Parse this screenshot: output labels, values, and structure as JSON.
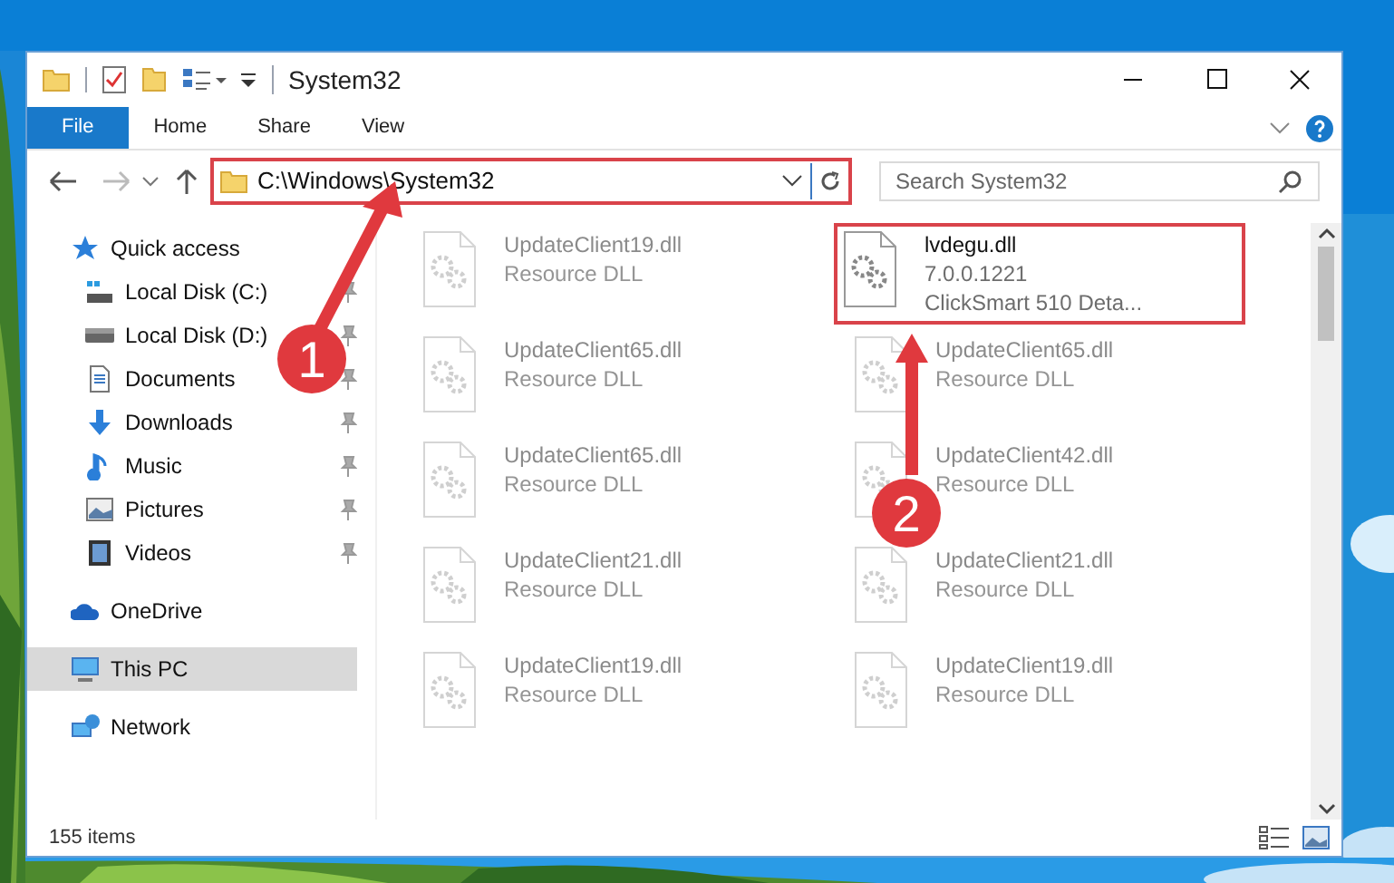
{
  "window": {
    "title": "System32"
  },
  "ribbon": {
    "tabs": [
      {
        "label": "File",
        "selected": true
      },
      {
        "label": "Home",
        "selected": false
      },
      {
        "label": "Share",
        "selected": false
      },
      {
        "label": "View",
        "selected": false
      }
    ]
  },
  "address_bar": {
    "path": "C:\\Windows\\System32",
    "highlighted": true
  },
  "search": {
    "placeholder": "Search System32"
  },
  "sidebar": {
    "items": [
      {
        "label": "Quick access",
        "kind": "star",
        "selected": false,
        "children": [
          {
            "label": "Local Disk (C:)",
            "kind": "system-drive",
            "pinned": true,
            "selected": false
          },
          {
            "label": "Local Disk (D:)",
            "kind": "drive",
            "pinned": true,
            "selected": false
          },
          {
            "label": "Documents",
            "kind": "documents",
            "pinned": true,
            "selected": false
          },
          {
            "label": "Downloads",
            "kind": "downloads",
            "pinned": true,
            "selected": false
          },
          {
            "label": "Music",
            "kind": "music",
            "pinned": true,
            "selected": false
          },
          {
            "label": "Pictures",
            "kind": "pictures",
            "pinned": true,
            "selected": false
          },
          {
            "label": "Videos",
            "kind": "videos",
            "pinned": true,
            "selected": false
          }
        ]
      },
      {
        "label": "OneDrive",
        "kind": "cloud",
        "selected": false
      },
      {
        "label": "This PC",
        "kind": "pc",
        "selected": true
      },
      {
        "label": "Network",
        "kind": "network",
        "selected": false
      }
    ]
  },
  "files": [
    {
      "name": "UpdateClient19.dll",
      "type": "Resource DLL",
      "blurred": true,
      "highlighted": false
    },
    {
      "name": "lvdegu.dll",
      "type": "7.0.0.1221",
      "description": "ClickSmart 510 Deta...",
      "blurred": false,
      "highlighted": true
    },
    {
      "name": "UpdateClient65.dll",
      "type": "Resource DLL",
      "blurred": true,
      "highlighted": false
    },
    {
      "name": "UpdateClient65.dll",
      "type": "Resource DLL",
      "blurred": true,
      "highlighted": false
    },
    {
      "name": "UpdateClient65.dll",
      "type": "Resource DLL",
      "blurred": true,
      "highlighted": false
    },
    {
      "name": "UpdateClient42.dll",
      "type": "Resource DLL",
      "blurred": true,
      "highlighted": false
    },
    {
      "name": "UpdateClient21.dll",
      "type": "Resource DLL",
      "blurred": true,
      "highlighted": false
    },
    {
      "name": "UpdateClient21.dll",
      "type": "Resource DLL",
      "blurred": true,
      "highlighted": false
    },
    {
      "name": "UpdateClient19.dll",
      "type": "Resource DLL",
      "blurred": true,
      "highlighted": false
    },
    {
      "name": "UpdateClient19.dll",
      "type": "Resource DLL",
      "blurred": true,
      "highlighted": false
    }
  ],
  "annotations": [
    {
      "label": "1"
    },
    {
      "label": "2"
    }
  ],
  "status_bar": {
    "item_count": "155 items"
  }
}
